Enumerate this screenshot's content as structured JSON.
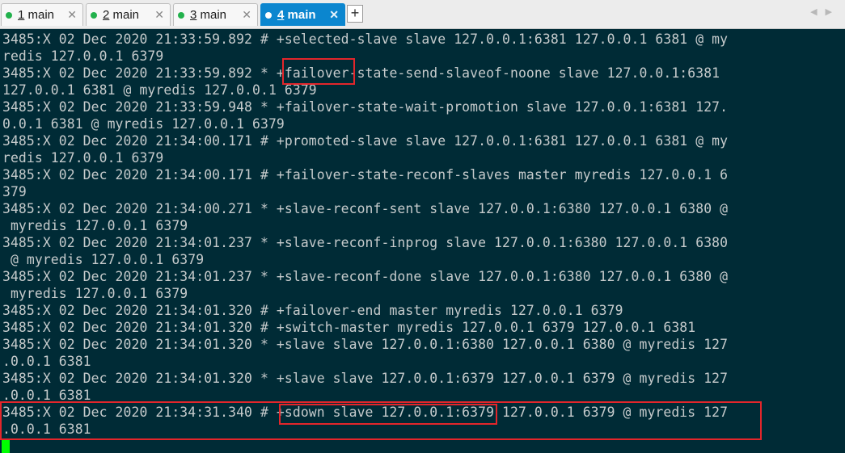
{
  "tabs": [
    {
      "num": "1",
      "label": " main",
      "dot_color": "#22b14c",
      "active": false
    },
    {
      "num": "2",
      "label": " main",
      "dot_color": "#22b14c",
      "active": false
    },
    {
      "num": "3",
      "label": " main",
      "dot_color": "#22b14c",
      "active": false
    },
    {
      "num": "4",
      "label": " main",
      "dot_color": "#ffffff",
      "active": true
    }
  ],
  "tab_close_glyph": "✕",
  "new_tab_glyph": "+",
  "scroll_arrows": "◀▶",
  "terminal": {
    "background": "#002b36",
    "cursor_color": "#00ff00",
    "highlight_color": "#e3262b",
    "lines": [
      "3485:X 02 Dec 2020 21:33:59.892 # +selected-slave slave 127.0.0.1:6381 127.0.0.1 6381 @ my",
      "redis 127.0.0.1 6379",
      "3485:X 02 Dec 2020 21:33:59.892 * +failover-state-send-slaveof-noone slave 127.0.0.1:6381",
      "127.0.0.1 6381 @ myredis 127.0.0.1 6379",
      "3485:X 02 Dec 2020 21:33:59.948 * +failover-state-wait-promotion slave 127.0.0.1:6381 127.",
      "0.0.1 6381 @ myredis 127.0.0.1 6379",
      "3485:X 02 Dec 2020 21:34:00.171 # +promoted-slave slave 127.0.0.1:6381 127.0.0.1 6381 @ my",
      "redis 127.0.0.1 6379",
      "3485:X 02 Dec 2020 21:34:00.171 # +failover-state-reconf-slaves master myredis 127.0.0.1 6",
      "379",
      "3485:X 02 Dec 2020 21:34:00.271 * +slave-reconf-sent slave 127.0.0.1:6380 127.0.0.1 6380 @",
      " myredis 127.0.0.1 6379",
      "3485:X 02 Dec 2020 21:34:01.237 * +slave-reconf-inprog slave 127.0.0.1:6380 127.0.0.1 6380",
      " @ myredis 127.0.0.1 6379",
      "3485:X 02 Dec 2020 21:34:01.237 * +slave-reconf-done slave 127.0.0.1:6380 127.0.0.1 6380 @",
      " myredis 127.0.0.1 6379",
      "3485:X 02 Dec 2020 21:34:01.320 # +failover-end master myredis 127.0.0.1 6379",
      "3485:X 02 Dec 2020 21:34:01.320 # +switch-master myredis 127.0.0.1 6379 127.0.0.1 6381",
      "3485:X 02 Dec 2020 21:34:01.320 * +slave slave 127.0.0.1:6380 127.0.0.1 6380 @ myredis 127",
      ".0.0.1 6381",
      "3485:X 02 Dec 2020 21:34:01.320 * +slave slave 127.0.0.1:6379 127.0.0.1 6379 @ myredis 127",
      ".0.0.1 6381",
      "3485:X 02 Dec 2020 21:34:31.340 # +sdown slave 127.0.0.1:6379 127.0.0.1 6379 @ myredis 127",
      ".0.0.1 6381"
    ]
  }
}
